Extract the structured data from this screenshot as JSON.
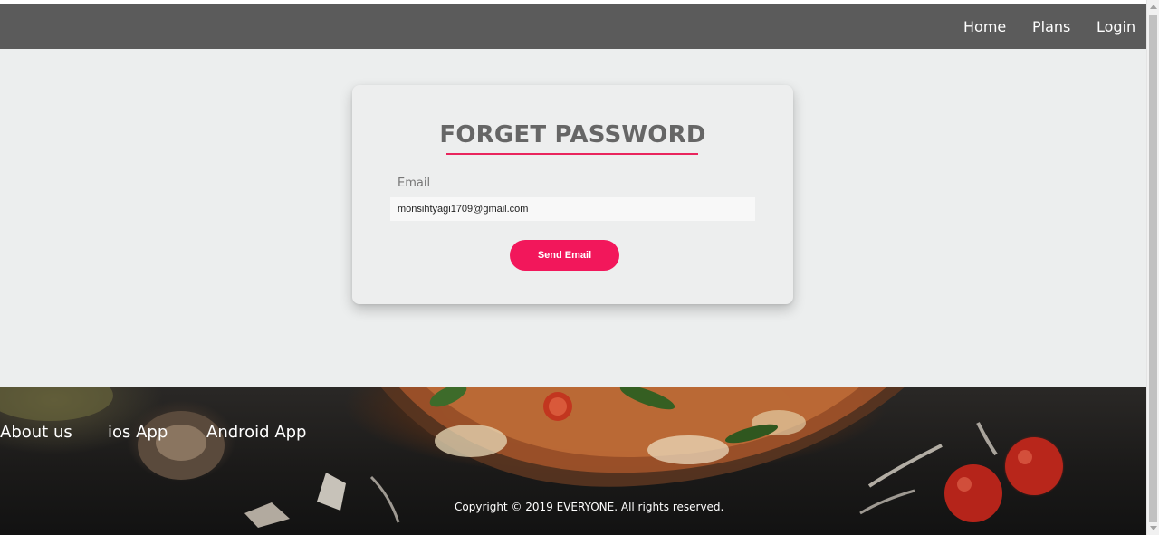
{
  "nav": {
    "items": [
      {
        "label": "Home"
      },
      {
        "label": "Plans"
      },
      {
        "label": "Login"
      }
    ]
  },
  "form": {
    "title": "FORGET PASSWORD",
    "email_label": "Email",
    "email_value": "monsihtyagi1709@gmail.com",
    "submit_label": "Send Email"
  },
  "footer": {
    "links": [
      {
        "label": "About us"
      },
      {
        "label": "ios App"
      },
      {
        "label": "Android App"
      }
    ],
    "copyright": "Copyright © 2019 EVERYONE. All rights reserved."
  },
  "colors": {
    "navbar_bg": "#5b5b5b",
    "page_bg": "#eceeee",
    "accent": "#f2175b",
    "title_text": "#666666"
  }
}
